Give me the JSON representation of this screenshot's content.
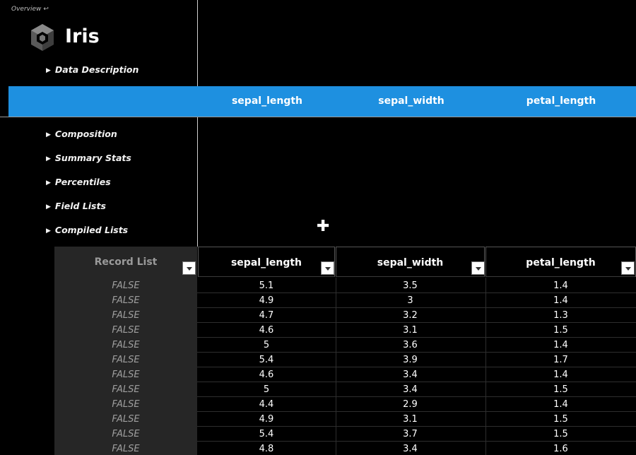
{
  "breadcrumb": {
    "label": "Overview",
    "back_glyph": "↩"
  },
  "app": {
    "title": "Iris",
    "logo_icon": "hex-cube-logo"
  },
  "sidebar": {
    "items": [
      {
        "label": "Data Description"
      },
      {
        "label": "Composition"
      },
      {
        "label": "Summary Stats"
      },
      {
        "label": "Percentiles"
      },
      {
        "label": "Field Lists"
      },
      {
        "label": "Compiled Lists"
      }
    ]
  },
  "band": {
    "color": "#1e90e0",
    "headers": [
      "sepal_length",
      "sepal_width",
      "petal_length"
    ]
  },
  "table": {
    "record_list_header": "Record List",
    "columns": [
      "sepal_length",
      "sepal_width",
      "petal_length"
    ],
    "rows": [
      {
        "flag": "FALSE",
        "values": [
          "5.1",
          "3.5",
          "1.4"
        ]
      },
      {
        "flag": "FALSE",
        "values": [
          "4.9",
          "3",
          "1.4"
        ]
      },
      {
        "flag": "FALSE",
        "values": [
          "4.7",
          "3.2",
          "1.3"
        ]
      },
      {
        "flag": "FALSE",
        "values": [
          "4.6",
          "3.1",
          "1.5"
        ]
      },
      {
        "flag": "FALSE",
        "values": [
          "5",
          "3.6",
          "1.4"
        ]
      },
      {
        "flag": "FALSE",
        "values": [
          "5.4",
          "3.9",
          "1.7"
        ]
      },
      {
        "flag": "FALSE",
        "values": [
          "4.6",
          "3.4",
          "1.4"
        ]
      },
      {
        "flag": "FALSE",
        "values": [
          "5",
          "3.4",
          "1.5"
        ]
      },
      {
        "flag": "FALSE",
        "values": [
          "4.4",
          "2.9",
          "1.4"
        ]
      },
      {
        "flag": "FALSE",
        "values": [
          "4.9",
          "3.1",
          "1.5"
        ]
      },
      {
        "flag": "FALSE",
        "values": [
          "5.4",
          "3.7",
          "1.5"
        ]
      },
      {
        "flag": "FALSE",
        "values": [
          "4.8",
          "3.4",
          "1.6"
        ]
      }
    ]
  }
}
